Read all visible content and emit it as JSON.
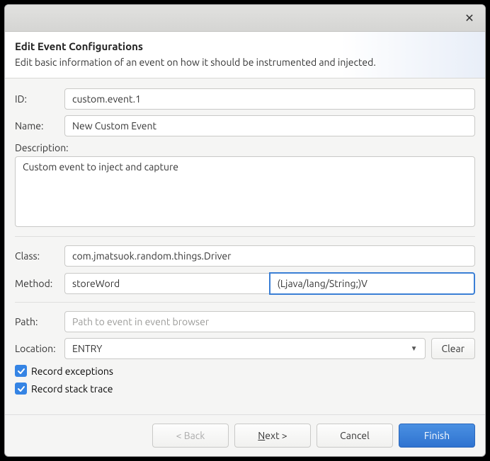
{
  "header": {
    "title": "Edit Event Configurations",
    "subtitle": "Edit basic information of an event on how it should be instrumented and injected."
  },
  "fields": {
    "id_label": "ID:",
    "id_value": "custom.event.1",
    "name_label": "Name:",
    "name_value": "New Custom Event",
    "description_label": "Description:",
    "description_value": "Custom event to inject and capture",
    "class_label": "Class:",
    "class_value": "com.jmatsuok.random.things.Driver",
    "method_label": "Method:",
    "method_name_value": "storeWord",
    "method_signature_value": "(Ljava/lang/String;)V",
    "path_label": "Path:",
    "path_value": "",
    "path_placeholder": "Path to event in event browser",
    "location_label": "Location:",
    "location_value": "ENTRY",
    "clear_label": "Clear",
    "record_exceptions_label": "Record exceptions",
    "record_stack_trace_label": "Record stack trace"
  },
  "checkboxes": {
    "record_exceptions": true,
    "record_stack_trace": true
  },
  "footer": {
    "back_label": "< Back",
    "next_label": "Next >",
    "cancel_label": "Cancel",
    "finish_label": "Finish"
  }
}
